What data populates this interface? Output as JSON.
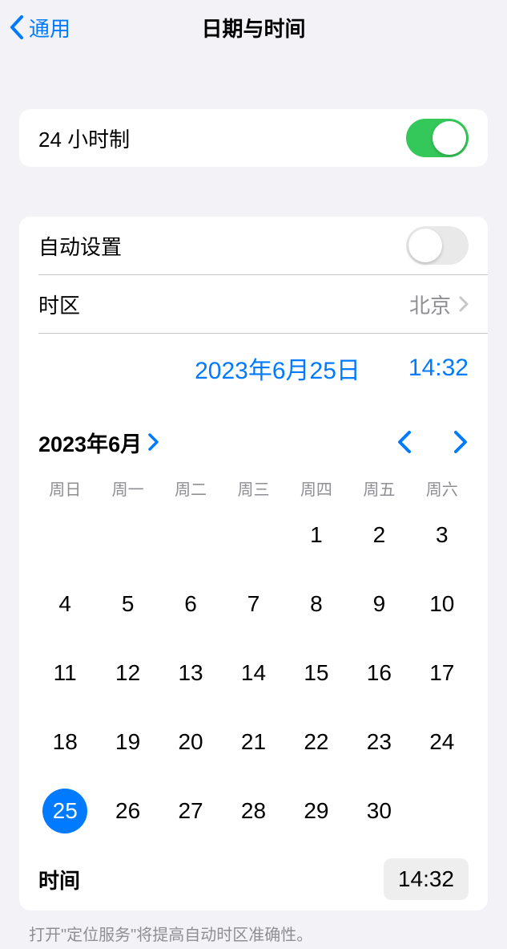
{
  "header": {
    "back_label": "通用",
    "title": "日期与时间"
  },
  "section_24h": {
    "label": "24 小时制",
    "enabled": true
  },
  "section_auto": {
    "auto_label": "自动设置",
    "auto_enabled": false,
    "timezone_label": "时区",
    "timezone_value": "北京",
    "date_display": "2023年6月25日",
    "time_display": "14:32"
  },
  "calendar": {
    "month_label": "2023年6月",
    "weekdays": [
      "周日",
      "周一",
      "周二",
      "周三",
      "周四",
      "周五",
      "周六"
    ],
    "leading_blanks": 4,
    "days_in_month": 30,
    "selected_day": 25,
    "time_label": "时间",
    "time_value": "14:32"
  },
  "footer": {
    "note": "打开\"定位服务\"将提高自动时区准确性。"
  },
  "colors": {
    "accent": "#007aff",
    "toggle_on": "#34c759",
    "bg": "#f2f2f7",
    "secondary_text": "#8e8e93"
  }
}
